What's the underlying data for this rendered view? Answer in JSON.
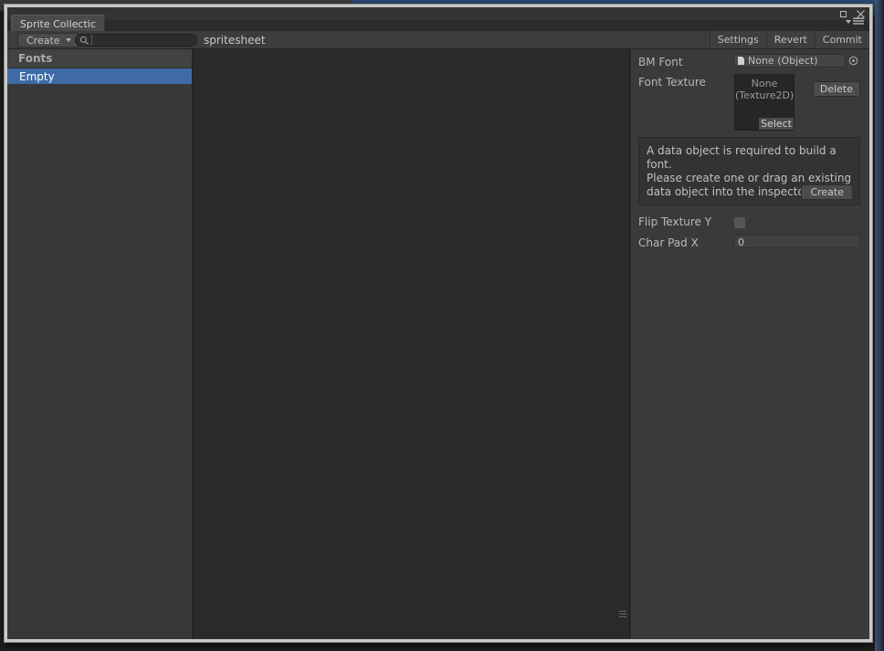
{
  "window": {
    "controls": {
      "maximize": "maximize-icon",
      "close": "×"
    },
    "menu_icon": "menu-dropdown-icon"
  },
  "tab": {
    "label": "Sprite Collectic"
  },
  "toolbar": {
    "create_label": "Create",
    "create_caret": "▾",
    "search_icon": "search-icon",
    "search_value": "",
    "search_placeholder": "",
    "document_name": "spritesheet",
    "buttons": [
      {
        "label": "Settings",
        "name": "settings-button"
      },
      {
        "label": "Revert",
        "name": "revert-button"
      },
      {
        "label": "Commit",
        "name": "commit-button"
      }
    ]
  },
  "sidebar": {
    "header": "Fonts",
    "items": [
      {
        "label": "Empty",
        "selected": true
      }
    ]
  },
  "inspector": {
    "bm_font": {
      "label": "BM Font",
      "value": "None (Object)",
      "picker_icon": "object-picker-icon"
    },
    "font_texture": {
      "label": "Font Texture",
      "preview_text": "None\n(Texture2D)",
      "select_label": "Select",
      "delete_label": "Delete"
    },
    "help": {
      "text": "A data object is required to build a font.\nPlease create one or drag an existing\ndata object into the inspector slot.",
      "create_label": "Create"
    },
    "flip_texture_y": {
      "label": "Flip Texture Y",
      "checked": false
    },
    "char_pad_x": {
      "label": "Char Pad X",
      "value": "0"
    }
  },
  "colors": {
    "selection_blue": "#3e6ba5",
    "panel_bg": "#3a3a3a",
    "canvas_bg": "#2a2a2a",
    "sidebar_bg": "#383838",
    "toolbar_bg": "#3c3c3c",
    "text": "#b8b8b8"
  }
}
